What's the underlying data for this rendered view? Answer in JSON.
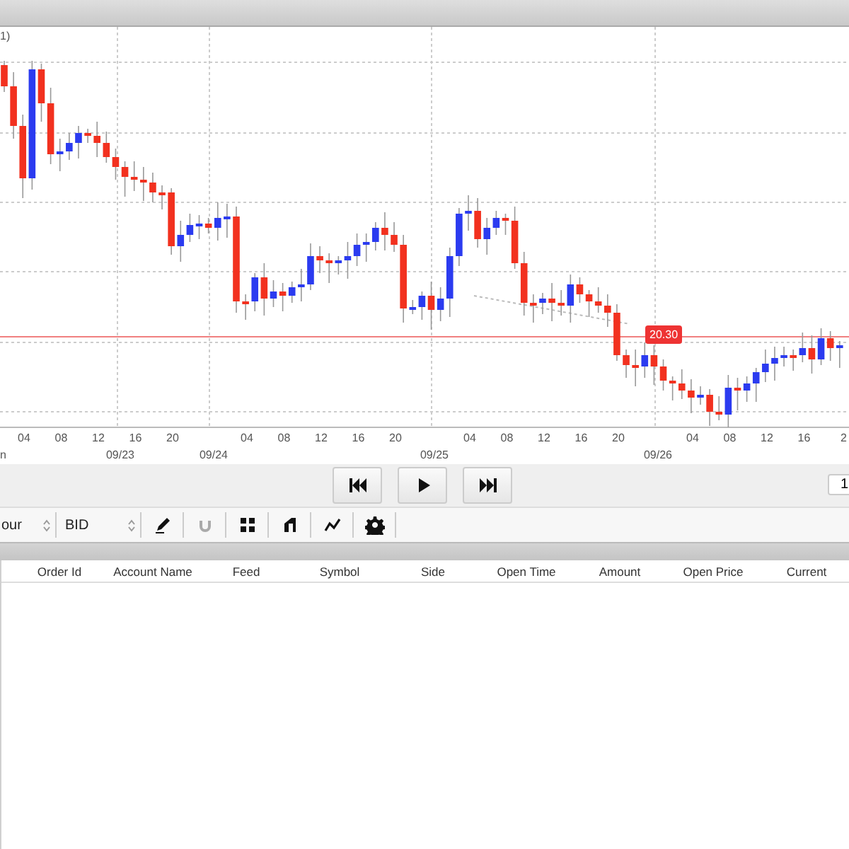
{
  "chart": {
    "corner_label": "1)",
    "price_tag": "20.30",
    "time_labels": [
      "04",
      "08",
      "12",
      "16",
      "20",
      "04",
      "08",
      "12",
      "16",
      "20",
      "04",
      "08",
      "12",
      "16",
      "20",
      "04",
      "08",
      "12",
      "16",
      "2"
    ],
    "date_labels": [
      "n",
      "09/23",
      "09/24",
      "09/25",
      "09/26"
    ]
  },
  "playback": {
    "buttons": [
      {
        "kind": "rewind"
      },
      {
        "kind": "play"
      },
      {
        "kind": "forward"
      }
    ],
    "counter": "1"
  },
  "toolbar": {
    "selects": [
      {
        "value": "our"
      },
      {
        "value": "BID"
      }
    ],
    "tools": [
      {
        "kind": "pencil",
        "disabled": false
      },
      {
        "kind": "magnet",
        "disabled": true
      },
      {
        "kind": "grid",
        "disabled": false
      },
      {
        "kind": "shape",
        "disabled": false
      },
      {
        "kind": "line",
        "disabled": false
      },
      {
        "kind": "gear",
        "disabled": false
      }
    ]
  },
  "orders_table": {
    "columns": [
      "Order Id",
      "Account Name",
      "Feed",
      "Symbol",
      "Side",
      "Open Time",
      "Amount",
      "Open Price",
      "Current"
    ]
  }
}
